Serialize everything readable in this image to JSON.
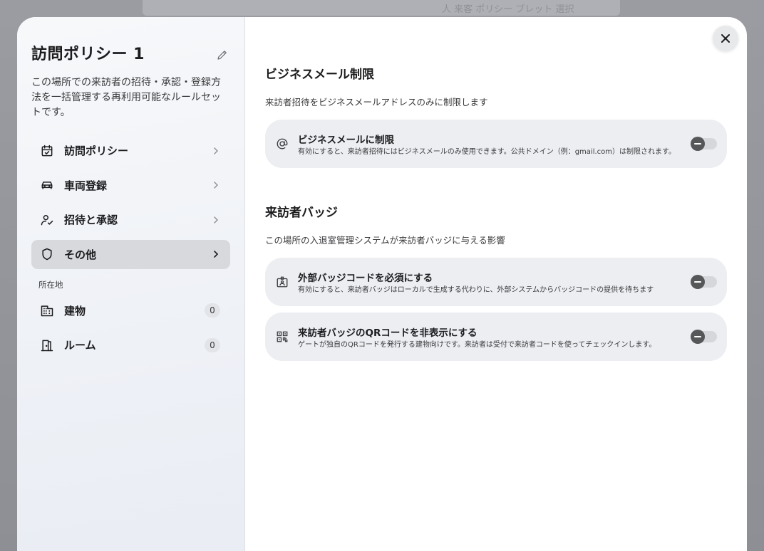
{
  "background": {
    "top_bar_text": "人 来客 ポリシー ブレット 選択"
  },
  "sidebar": {
    "title": "訪問ポリシー 1",
    "description": "この場所での来訪者の招待・承認・登録方法を一括管理する再利用可能なルールセットです。",
    "items": [
      {
        "label": "訪問ポリシー",
        "icon": "calendar-check-icon",
        "active": false
      },
      {
        "label": "車両登録",
        "icon": "car-icon",
        "active": false
      },
      {
        "label": "招待と承認",
        "icon": "user-check-icon",
        "active": false
      },
      {
        "label": "その他",
        "icon": "shield-icon",
        "active": true
      }
    ],
    "location_section_label": "所在地",
    "location_items": [
      {
        "label": "建物",
        "icon": "building-icon",
        "count": "0"
      },
      {
        "label": "ルーム",
        "icon": "door-icon",
        "count": "0"
      }
    ]
  },
  "content": {
    "business_email": {
      "title": "ビジネスメール制限",
      "subtitle": "来訪者招待をビジネスメールアドレスのみに制限します",
      "cards": [
        {
          "title": "ビジネスメールに制限",
          "description": "有効にすると、来訪者招待にはビジネスメールのみ使用できます。公共ドメイン（例：gmail.com）は制限されます。",
          "icon": "at-sign-icon",
          "enabled": false
        }
      ]
    },
    "visitor_badge": {
      "title": "来訪者バッジ",
      "subtitle": "この場所の入退室管理システムが来訪者バッジに与える影響",
      "cards": [
        {
          "title": "外部バッジコードを必須にする",
          "description": "有効にすると、来訪者バッジはローカルで生成する代わりに、外部システムからバッジコードの提供を待ちます",
          "icon": "id-badge-icon",
          "enabled": false
        },
        {
          "title": "来訪者バッジのQRコードを非表示にする",
          "description": "ゲートが独自のQRコードを発行する建物向けです。来訪者は受付で来訪者コードを使ってチェックインします。",
          "icon": "qr-code-icon",
          "enabled": false
        }
      ]
    }
  }
}
